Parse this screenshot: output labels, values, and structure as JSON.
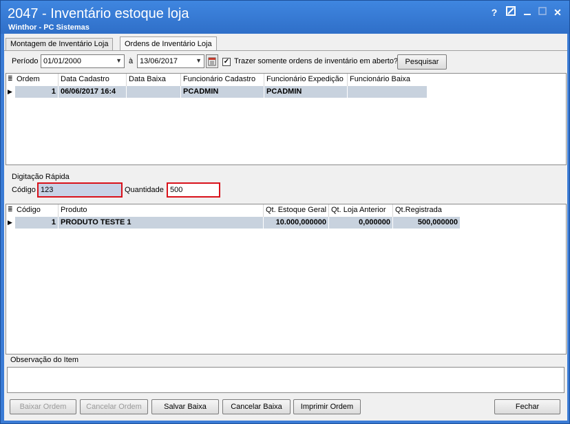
{
  "window": {
    "title": "2047 - Inventário estoque loja",
    "subtitle": "Winthor - PC Sistemas",
    "help_glyph": "?",
    "close_glyph": "✕"
  },
  "tabs": [
    {
      "label": "Montagem de Inventário Loja"
    },
    {
      "label": "Ordens de Inventário Loja"
    }
  ],
  "filter": {
    "periodo_label": "Período",
    "date_from": "01/01/2000",
    "a_label": "à",
    "date_to": "13/06/2017",
    "only_open_label": "Trazer somente ordens de inventário em aberto?",
    "only_open_checked": true,
    "search_button": "Pesquisar"
  },
  "orders_grid": {
    "headers": [
      "Ordem",
      "Data Cadastro",
      "Data Baixa",
      "Funcionário Cadastro",
      "Funcionário Expedição",
      "Funcionário Baixa"
    ],
    "rows": [
      {
        "ordem": "1",
        "data_cadastro": "06/06/2017 16:4",
        "data_baixa": "",
        "func_cadastro": "PCADMIN",
        "func_expedicao": "PCADMIN",
        "func_baixa": ""
      }
    ]
  },
  "quick_entry": {
    "section_label": "Digitação Rápida",
    "codigo_label": "Código",
    "codigo_value": "123",
    "quantidade_label": "Quantidade",
    "quantidade_value": "500"
  },
  "items_grid": {
    "headers": [
      "Código",
      "Produto",
      "Qt. Estoque Geral",
      "Qt. Loja Anterior",
      "Qt.Registrada"
    ],
    "rows": [
      {
        "codigo": "1",
        "produto": "PRODUTO TESTE 1",
        "estoque_geral": "10.000,000000",
        "loja_anterior": "0,000000",
        "registrada": "500,000000"
      }
    ]
  },
  "observacao": {
    "label": "Observação do Item",
    "value": ""
  },
  "buttons": {
    "baixar": "Baixar Ordem",
    "cancelar_ordem": "Cancelar Ordem",
    "salvar_baixa": "Salvar Baixa",
    "cancelar_baixa": "Cancelar Baixa",
    "imprimir": "Imprimir Ordem",
    "fechar": "Fechar"
  }
}
